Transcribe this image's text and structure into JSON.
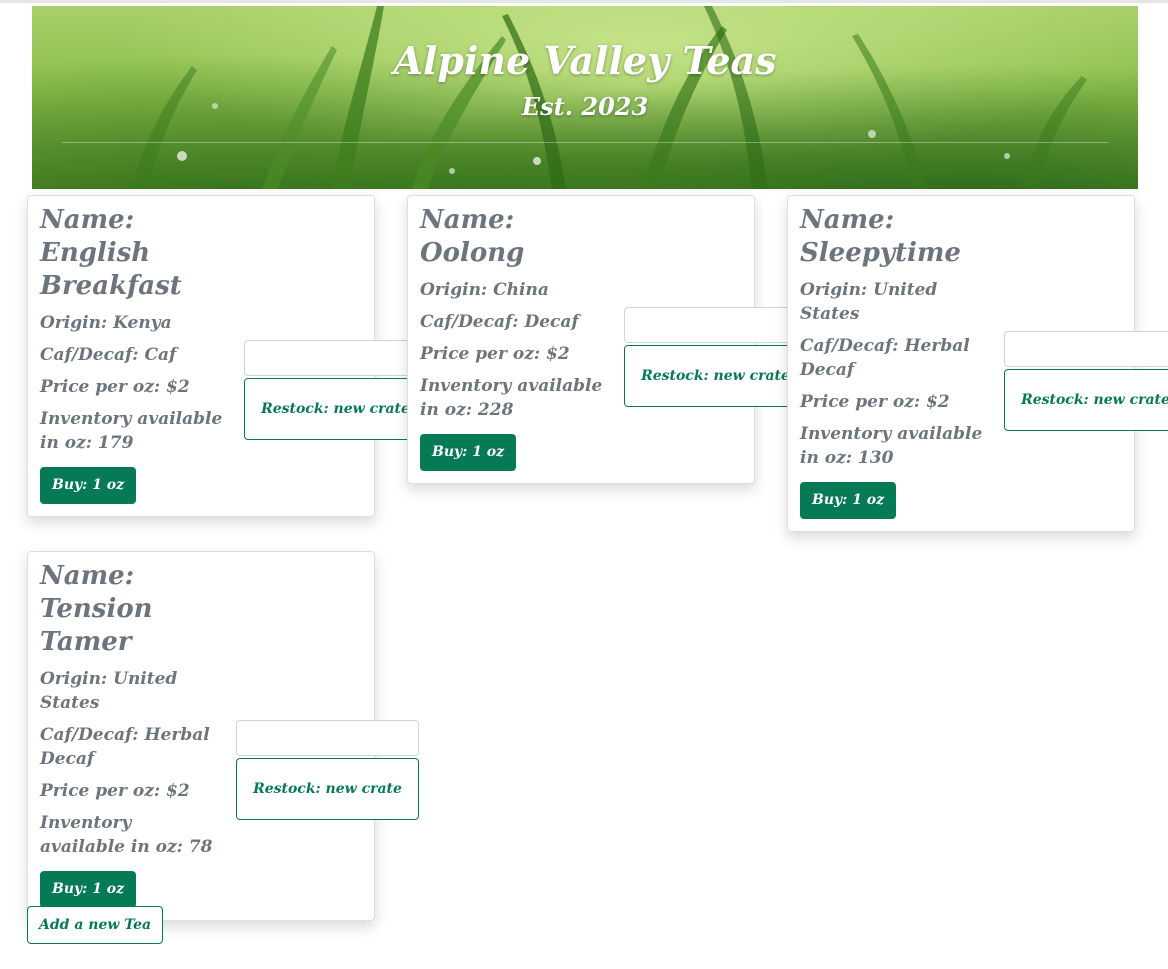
{
  "header": {
    "title": "Alpine Valley Teas",
    "subtitle": "Est. 2023"
  },
  "teas": [
    {
      "name": "Name: English Breakfast",
      "origin": "Origin: Kenya",
      "caf": "Caf/Decaf: Caf",
      "price": "Price per oz: $2",
      "inventory": "Inventory available in oz: 179",
      "buy_label": "Buy: 1 oz",
      "restock_label": "Restock: new crate",
      "restock_value": ""
    },
    {
      "name": "Name: Oolong",
      "origin": "Origin: China",
      "caf": "Caf/Decaf: Decaf",
      "price": "Price per oz: $2",
      "inventory": "Inventory available in oz: 228",
      "buy_label": "Buy: 1 oz",
      "restock_label": "Restock: new crate",
      "restock_value": ""
    },
    {
      "name": "Name: Sleepytime",
      "origin": "Origin: United States",
      "caf": "Caf/Decaf: Herbal Decaf",
      "price": "Price per oz: $2",
      "inventory": "Inventory available in oz: 130",
      "buy_label": "Buy: 1 oz",
      "restock_label": "Restock: new crate",
      "restock_value": ""
    },
    {
      "name": "Name: Tension Tamer",
      "origin": "Origin: United States",
      "caf": "Caf/Decaf: Herbal Decaf",
      "price": "Price per oz: $2",
      "inventory": "Inventory available in oz: 78",
      "buy_label": "Buy: 1 oz",
      "restock_label": "Restock: new crate",
      "restock_value": ""
    }
  ],
  "add_tea_label": "Add a new Tea",
  "colors": {
    "accent": "#057a55",
    "text": "#6c757d"
  }
}
